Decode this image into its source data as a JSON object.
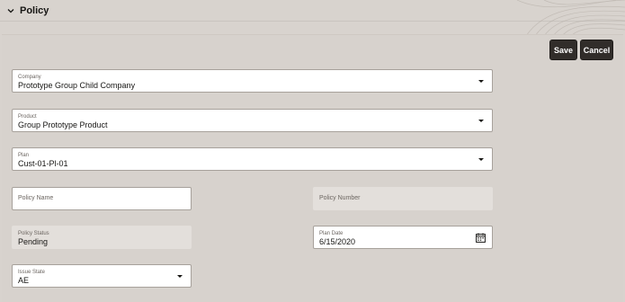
{
  "section": {
    "title": "Policy"
  },
  "toolbar": {
    "save_label": "Save",
    "cancel_label": "Cancel"
  },
  "form": {
    "company": {
      "label": "Company",
      "value": "Prototype Group Child Company"
    },
    "product": {
      "label": "Product",
      "value": "Group Prototype Product"
    },
    "plan": {
      "label": "Plan",
      "value": "Cust-01-Pl-01"
    },
    "policy_name": {
      "placeholder": "Policy Name"
    },
    "policy_number": {
      "placeholder": "Policy Number"
    },
    "policy_status": {
      "label": "Policy Status",
      "value": "Pending"
    },
    "plan_date": {
      "label": "Plan Date",
      "value": "6/15/2020"
    },
    "issue_state": {
      "label": "Issue State",
      "value": "AE"
    }
  },
  "icons": {
    "collapse": "chevron-down-icon",
    "dropdown": "caret-down-icon",
    "calendar": "calendar-icon"
  },
  "colors": {
    "background": "#d8d3ce",
    "button": "#312d2a",
    "field": "#ffffff",
    "readonly_field": "#e3dfdb"
  }
}
